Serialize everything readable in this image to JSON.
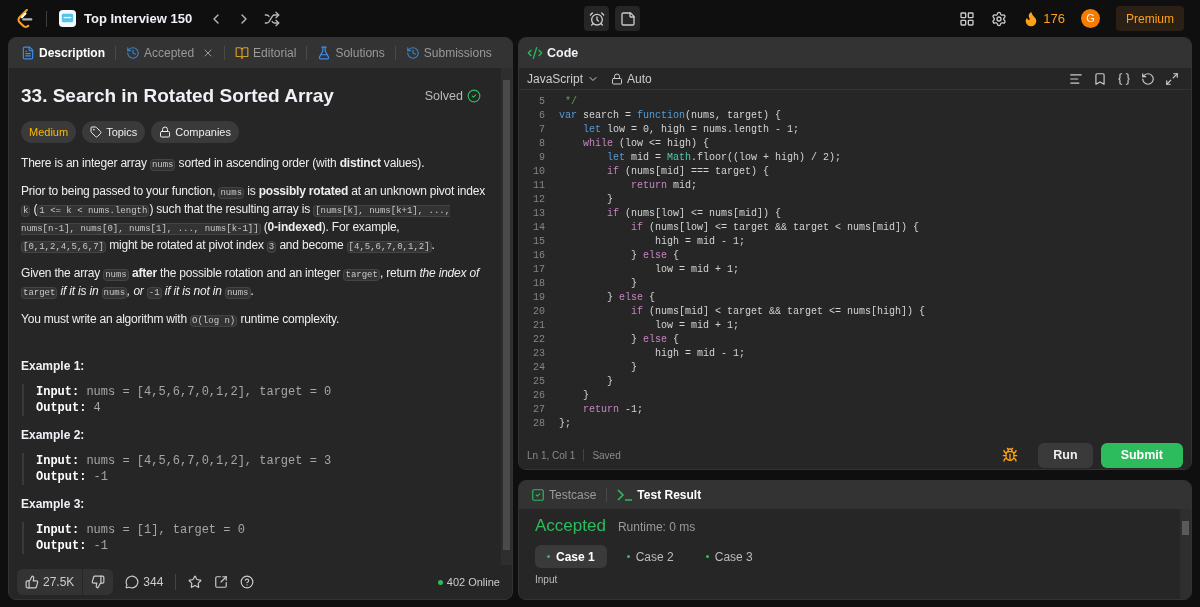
{
  "top_bar": {
    "problem_list": "Top Interview 150",
    "streak": "176",
    "avatar": "G",
    "premium": "Premium"
  },
  "left_tabs": [
    {
      "label": "Description",
      "selected": true,
      "closable": false
    },
    {
      "label": "Accepted",
      "selected": false,
      "closable": true
    },
    {
      "label": "Editorial",
      "selected": false,
      "closable": false
    },
    {
      "label": "Solutions",
      "selected": false,
      "closable": false
    },
    {
      "label": "Submissions",
      "selected": false,
      "closable": false
    }
  ],
  "problem": {
    "title": "33. Search in Rotated Sorted Array",
    "status": "Solved",
    "difficulty": "Medium",
    "tags": [
      {
        "label": "Topics"
      },
      {
        "label": "Companies"
      }
    ],
    "paragraphs": [
      [
        {
          "kind": "text",
          "text": "There is an integer array "
        },
        {
          "kind": "code",
          "text": "nums"
        },
        {
          "kind": "text",
          "text": " sorted in ascending order (with **distinct** values)."
        }
      ],
      [
        {
          "kind": "text",
          "text": "Prior to being passed to your function, "
        },
        {
          "kind": "code",
          "text": "nums"
        },
        {
          "kind": "text",
          "text": " is **possibly rotated** at an unknown pivot index "
        },
        {
          "kind": "code",
          "text": "k"
        },
        {
          "kind": "text",
          "text": " ("
        },
        {
          "kind": "code",
          "text": "1 <= k < nums.length"
        },
        {
          "kind": "text",
          "text": ") such that the resulting array is "
        },
        {
          "kind": "code",
          "text": "[nums[k], nums[k+1], ..., nums[n-1], nums[0], nums[1], ..., nums[k-1]]"
        },
        {
          "kind": "text",
          "text": " (**0-indexed**). For example, "
        },
        {
          "kind": "code",
          "text": "[0,1,2,4,5,6,7]"
        },
        {
          "kind": "text",
          "text": " might be rotated at pivot index "
        },
        {
          "kind": "code",
          "text": "3"
        },
        {
          "kind": "text",
          "text": " and become "
        },
        {
          "kind": "code",
          "text": "[4,5,6,7,0,1,2]"
        },
        {
          "kind": "text",
          "text": "."
        }
      ],
      [
        {
          "kind": "text",
          "text": "Given the array "
        },
        {
          "kind": "code",
          "text": "nums"
        },
        {
          "kind": "text",
          "text": " **after** the possible rotation and an integer "
        },
        {
          "kind": "code",
          "text": "target"
        },
        {
          "kind": "text",
          "text": ", return *the index of* "
        },
        {
          "kind": "code",
          "text": "target"
        },
        {
          "kind": "text",
          "text": " *if it is in* "
        },
        {
          "kind": "code",
          "text": "nums"
        },
        {
          "kind": "text",
          "text": "*, or* "
        },
        {
          "kind": "code",
          "text": "-1"
        },
        {
          "kind": "text",
          "text": " *if it is not in* "
        },
        {
          "kind": "code",
          "text": "nums"
        },
        {
          "kind": "text",
          "text": "."
        }
      ],
      [
        {
          "kind": "text",
          "text": "You must write an algorithm with "
        },
        {
          "kind": "code",
          "text": "O(log n)"
        },
        {
          "kind": "text",
          "text": " runtime complexity."
        }
      ]
    ],
    "examples": [
      {
        "title": "Example 1:",
        "lines": [
          "**Input:** nums = [4,5,6,7,0,1,2], target = 0",
          "**Output:** 4"
        ]
      },
      {
        "title": "Example 2:",
        "lines": [
          "**Input:** nums = [4,5,6,7,0,1,2], target = 3",
          "**Output:** -1"
        ]
      },
      {
        "title": "Example 3:",
        "lines": [
          "**Input:** nums = [1], target = 0",
          "**Output:** -1"
        ]
      }
    ]
  },
  "footer": {
    "likes": "27.5K",
    "comments": "344",
    "online": "402 Online"
  },
  "code_panel": {
    "title": "Code",
    "language": "JavaScript",
    "mode": "Auto",
    "lines": [
      {
        "number": "5",
        "tokens": [
          {
            "kind": "cm",
            "text": " */"
          }
        ]
      },
      {
        "number": "6",
        "tokens": [
          {
            "kind": "kw",
            "text": "var"
          },
          {
            "kind": "p",
            "text": " search = "
          },
          {
            "kind": "kw",
            "text": "function"
          },
          {
            "kind": "p",
            "text": "(nums, target) {"
          }
        ]
      },
      {
        "number": "7",
        "tokens": [
          {
            "kind": "kw",
            "text": "    let"
          },
          {
            "kind": "p",
            "text": " low = 0, high = nums.length - 1;"
          }
        ]
      },
      {
        "number": "8",
        "tokens": [
          {
            "kind": "ctl",
            "text": "    while"
          },
          {
            "kind": "p",
            "text": " (low <= high) {"
          }
        ]
      },
      {
        "number": "9",
        "tokens": [
          {
            "kind": "kw",
            "text": "        let"
          },
          {
            "kind": "p",
            "text": " mid = "
          },
          {
            "kind": "cls",
            "text": "Math"
          },
          {
            "kind": "p",
            "text": ".floor((low + high) / 2);"
          }
        ]
      },
      {
        "number": "10",
        "tokens": [
          {
            "kind": "ctl",
            "text": "        if"
          },
          {
            "kind": "p",
            "text": " (nums[mid] === target) {"
          }
        ]
      },
      {
        "number": "11",
        "tokens": [
          {
            "kind": "ctl",
            "text": "            return"
          },
          {
            "kind": "p",
            "text": " mid;"
          }
        ]
      },
      {
        "number": "12",
        "tokens": [
          {
            "kind": "p",
            "text": "        }"
          }
        ]
      },
      {
        "number": "13",
        "tokens": [
          {
            "kind": "ctl",
            "text": "        if"
          },
          {
            "kind": "p",
            "text": " (nums[low] <= nums[mid]) {"
          }
        ]
      },
      {
        "number": "14",
        "tokens": [
          {
            "kind": "ctl",
            "text": "            if"
          },
          {
            "kind": "p",
            "text": " (nums[low] <= target && target < nums[mid]) {"
          }
        ]
      },
      {
        "number": "15",
        "tokens": [
          {
            "kind": "p",
            "text": "                high = mid - 1;"
          }
        ]
      },
      {
        "number": "16",
        "tokens": [
          {
            "kind": "p",
            "text": "            } "
          },
          {
            "kind": "ctl",
            "text": "else"
          },
          {
            "kind": "p",
            "text": " {"
          }
        ]
      },
      {
        "number": "17",
        "tokens": [
          {
            "kind": "p",
            "text": "                low = mid + 1;"
          }
        ]
      },
      {
        "number": "18",
        "tokens": [
          {
            "kind": "p",
            "text": "            }"
          }
        ]
      },
      {
        "number": "19",
        "tokens": [
          {
            "kind": "p",
            "text": "        } "
          },
          {
            "kind": "ctl",
            "text": "else"
          },
          {
            "kind": "p",
            "text": " {"
          }
        ]
      },
      {
        "number": "20",
        "tokens": [
          {
            "kind": "ctl",
            "text": "            if"
          },
          {
            "kind": "p",
            "text": " (nums[mid] < target && target <= nums[high]) {"
          }
        ]
      },
      {
        "number": "21",
        "tokens": [
          {
            "kind": "p",
            "text": "                low = mid + 1;"
          }
        ]
      },
      {
        "number": "22",
        "tokens": [
          {
            "kind": "p",
            "text": "            } "
          },
          {
            "kind": "ctl",
            "text": "else"
          },
          {
            "kind": "p",
            "text": " {"
          }
        ]
      },
      {
        "number": "23",
        "tokens": [
          {
            "kind": "p",
            "text": "                high = mid - 1;"
          }
        ]
      },
      {
        "number": "24",
        "tokens": [
          {
            "kind": "p",
            "text": "            }"
          }
        ]
      },
      {
        "number": "25",
        "tokens": [
          {
            "kind": "p",
            "text": "        }"
          }
        ]
      },
      {
        "number": "26",
        "tokens": [
          {
            "kind": "p",
            "text": "    }"
          }
        ]
      },
      {
        "number": "27",
        "tokens": [
          {
            "kind": "ctl",
            "text": "    return"
          },
          {
            "kind": "p",
            "text": " -1;"
          }
        ]
      },
      {
        "number": "28",
        "tokens": [
          {
            "kind": "p",
            "text": "};"
          }
        ]
      }
    ],
    "cursor": "Ln 1, Col 1",
    "save_state": "Saved",
    "buttons": [
      {
        "label": "Run",
        "kind": "secondary"
      },
      {
        "label": "Submit",
        "kind": "primary"
      }
    ]
  },
  "test_panel": {
    "tabs": [
      {
        "label": "Testcase",
        "selected": false
      },
      {
        "label": "Test Result",
        "selected": true
      }
    ],
    "verdict": "Accepted",
    "runtime": "Runtime: 0 ms",
    "cases": [
      {
        "label": "Case 1",
        "selected": true
      },
      {
        "label": "Case 2",
        "selected": false
      },
      {
        "label": "Case 3",
        "selected": false
      }
    ],
    "section_label": "Input"
  }
}
